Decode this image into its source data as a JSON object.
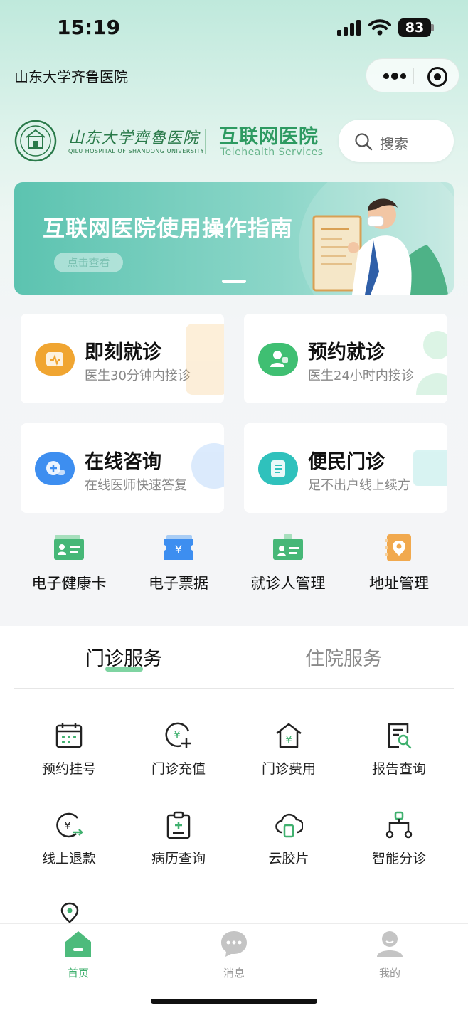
{
  "status_bar": {
    "time": "15:19",
    "battery": "83"
  },
  "nav": {
    "title": "山东大学齐鲁医院"
  },
  "brand": {
    "name_cn": "山东大学齊魯医院",
    "name_en": "QILU HOSPITAL OF SHANDONG UNIVERSITY",
    "hospital": "互联网医院",
    "tagline": "Telehealth Services"
  },
  "search": {
    "label": "搜索"
  },
  "banner": {
    "title": "互联网医院使用操作指南",
    "button": "点击查看"
  },
  "cards": [
    {
      "title": "即刻就诊",
      "subtitle": "医生30分钟内接诊",
      "color": "#f0a531"
    },
    {
      "title": "预约就诊",
      "subtitle": "医生24小时内接诊",
      "color": "#3fbf72"
    },
    {
      "title": "在线咨询",
      "subtitle": "在线医师快速答复",
      "color": "#3d8ef0"
    },
    {
      "title": "便民门诊",
      "subtitle": "足不出户线上续方",
      "color": "#2fc1bc"
    }
  ],
  "quick_links": [
    {
      "label": "电子健康卡",
      "icon": "health-card-icon"
    },
    {
      "label": "电子票据",
      "icon": "receipt-icon"
    },
    {
      "label": "就诊人管理",
      "icon": "patient-id-icon"
    },
    {
      "label": "地址管理",
      "icon": "address-icon"
    }
  ],
  "tabs": {
    "outpatient": "门诊服务",
    "inpatient": "住院服务",
    "active": "outpatient"
  },
  "services": [
    {
      "label": "预约挂号",
      "icon": "calendar-icon"
    },
    {
      "label": "门诊充值",
      "icon": "recharge-icon"
    },
    {
      "label": "门诊费用",
      "icon": "fee-house-icon"
    },
    {
      "label": "报告查询",
      "icon": "report-search-icon"
    },
    {
      "label": "线上退款",
      "icon": "refund-icon"
    },
    {
      "label": "病历查询",
      "icon": "medical-record-icon"
    },
    {
      "label": "云胶片",
      "icon": "cloud-film-icon"
    },
    {
      "label": "智能分诊",
      "icon": "triage-icon"
    }
  ],
  "tabbar": [
    {
      "label": "首页",
      "active": true
    },
    {
      "label": "消息",
      "active": false
    },
    {
      "label": "我的",
      "active": false
    }
  ],
  "colors": {
    "accent": "#3fb06e",
    "inactive": "#999999"
  }
}
